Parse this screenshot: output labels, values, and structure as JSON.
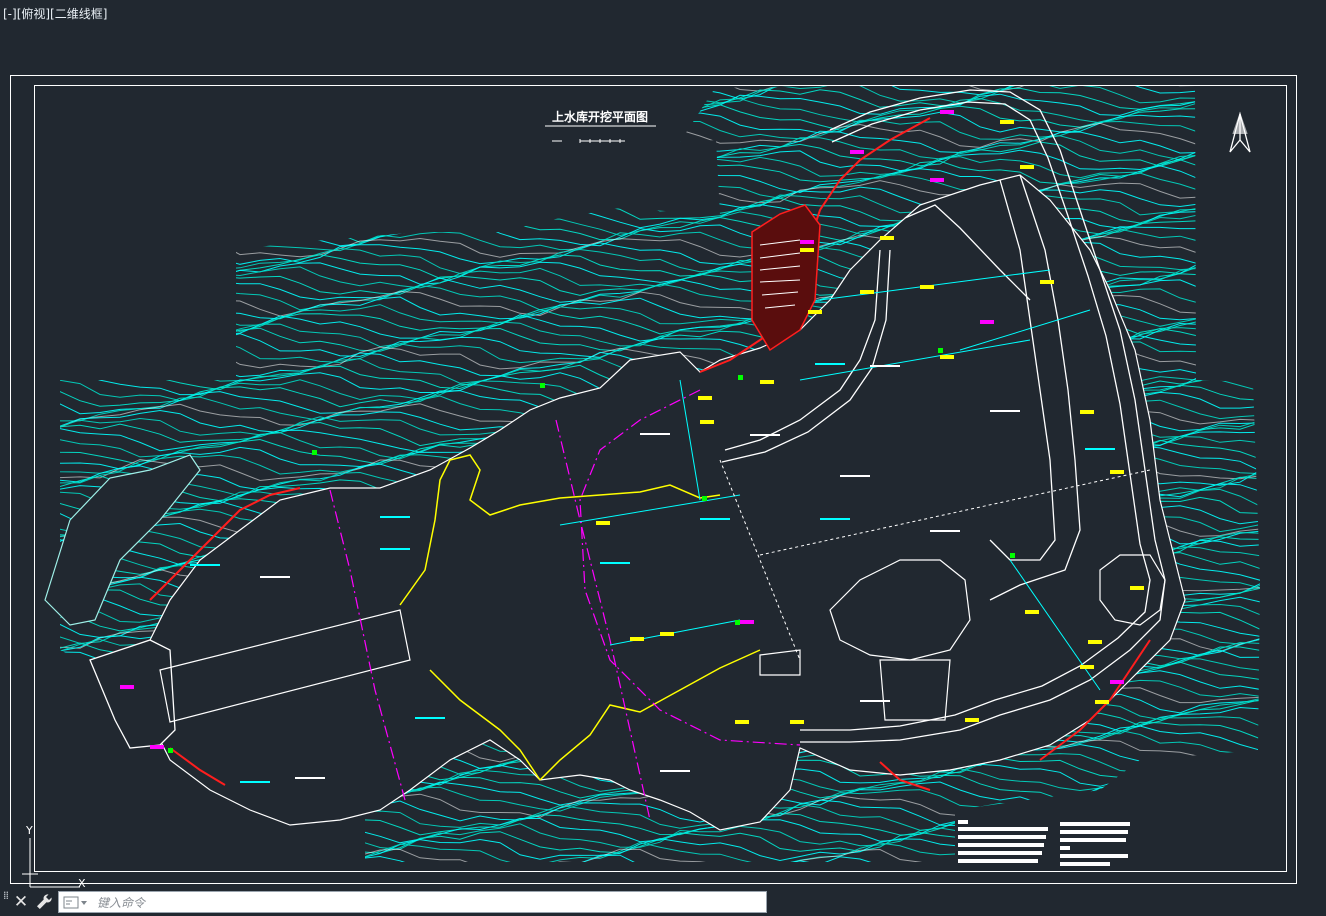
{
  "viewport": {
    "label": "[-][俯视][二维线框]"
  },
  "drawing": {
    "title": "上水库开挖平面图",
    "ucs_x": "X",
    "ucs_y": "Y",
    "colors": {
      "background": "#212830",
      "frame": "#ffffff",
      "contour": "#00e8d0",
      "contour_alt": "#00ffff",
      "boundary_yellow": "#ffff00",
      "axis_magenta": "#ff00ff",
      "excavation_red": "#ff1e1e",
      "road_white": "#ffffff",
      "accent_green": "#00ff00"
    }
  },
  "commandbar": {
    "close_icon": "close-icon",
    "customize_icon": "wrench-icon",
    "prompt_icon": "command-prompt-icon",
    "placeholder": "键入命令"
  }
}
